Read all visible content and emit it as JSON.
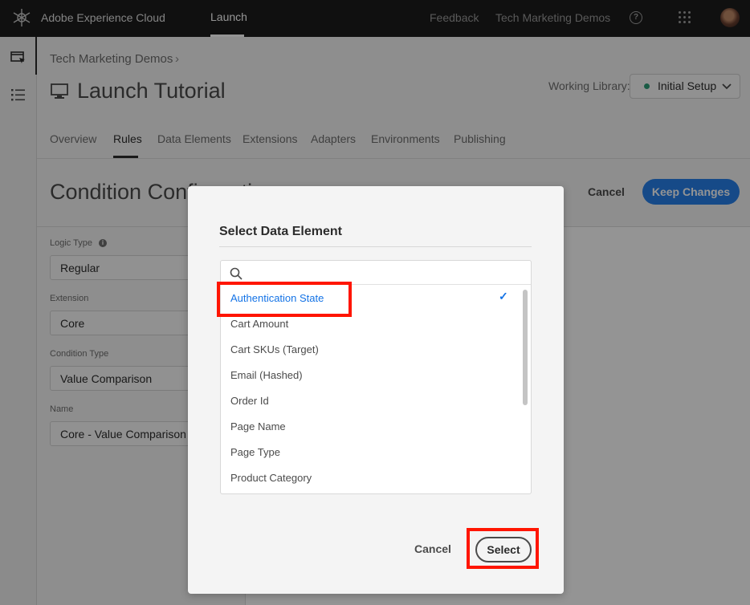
{
  "shell": {
    "brand": "Adobe Experience Cloud",
    "nav_active": "Launch",
    "feedback": "Feedback",
    "org": "Tech Marketing Demos",
    "help_glyph": "?"
  },
  "rail": {
    "icons": [
      "properties-icon",
      "list-icon"
    ]
  },
  "header": {
    "breadcrumb": "Tech Marketing Demos",
    "breadcrumb_separator": "›",
    "property_title": "Launch Tutorial",
    "working_library_label": "Working Library:",
    "working_library_value": "Initial Setup",
    "working_library_status_color": "#2d9d78",
    "tabs": [
      {
        "label": "Overview"
      },
      {
        "label": "Rules"
      },
      {
        "label": "Data Elements"
      },
      {
        "label": "Extensions"
      },
      {
        "label": "Adapters"
      },
      {
        "label": "Environments"
      },
      {
        "label": "Publishing"
      }
    ],
    "active_tab": "Rules"
  },
  "page": {
    "title": "Condition Configuration",
    "cancel_label": "Cancel",
    "keep_label": "Keep Changes",
    "accent_color": "#2680eb"
  },
  "form": {
    "logic_type_label": "Logic Type",
    "logic_type_value": "Regular",
    "extension_label": "Extension",
    "extension_value": "Core",
    "condition_type_label": "Condition Type",
    "condition_type_value": "Value Comparison",
    "name_label": "Name",
    "name_value": "Core - Value Comparison"
  },
  "modal": {
    "title": "Select Data Element",
    "search_placeholder": "",
    "options": [
      {
        "label": "Authentication State",
        "selected": true
      },
      {
        "label": "Cart Amount"
      },
      {
        "label": "Cart SKUs (Target)"
      },
      {
        "label": "Email (Hashed)"
      },
      {
        "label": "Order Id"
      },
      {
        "label": "Page Name"
      },
      {
        "label": "Page Type"
      },
      {
        "label": "Product Category"
      }
    ],
    "cancel_label": "Cancel",
    "select_label": "Select",
    "highlight_color": "#ff1500"
  }
}
